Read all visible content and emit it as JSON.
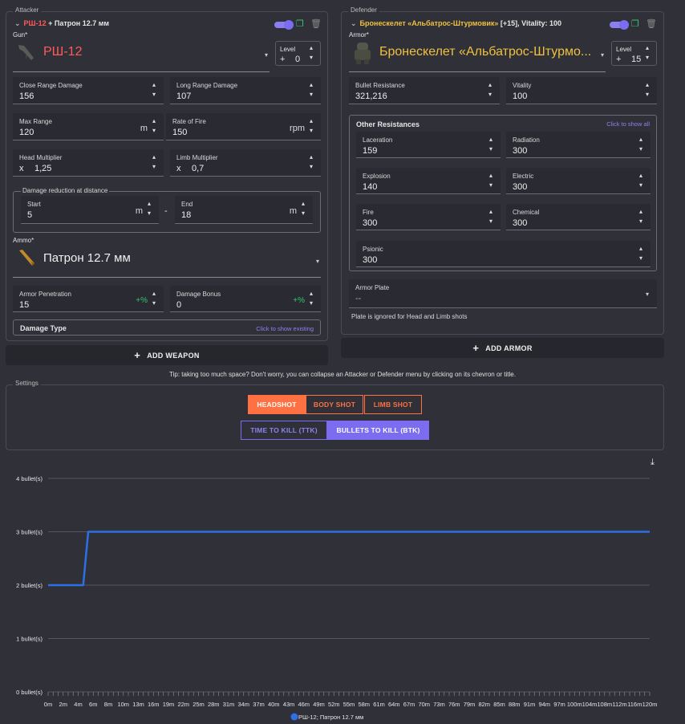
{
  "attacker": {
    "legend": "Attacker",
    "title_weapon": "РШ-12",
    "title_rest": "+ Патрон 12.7 мм",
    "gun_label": "Gun*",
    "gun_name": "РШ-12",
    "level_label": "Level",
    "level_plus": "+",
    "level_value": "0",
    "close_range_damage": {
      "label": "Close Range Damage",
      "value": "156"
    },
    "long_range_damage": {
      "label": "Long Range Damage",
      "value": "107"
    },
    "max_range": {
      "label": "Max Range",
      "value": "120",
      "unit": "m"
    },
    "rate_of_fire": {
      "label": "Rate of Fire",
      "value": "150",
      "unit": "rpm"
    },
    "head_multiplier": {
      "label": "Head Multiplier",
      "prefix": "x",
      "value": "1,25"
    },
    "limb_multiplier": {
      "label": "Limb Multiplier",
      "prefix": "x",
      "value": "0,7"
    },
    "damage_reduction": {
      "label": "Damage reduction at distance",
      "start_label": "Start",
      "start_value": "5",
      "start_unit": "m",
      "dash": "-",
      "end_label": "End",
      "end_value": "18",
      "end_unit": "m"
    },
    "ammo_label": "Ammo*",
    "ammo_name": "Патрон 12.7 мм",
    "armor_penetration": {
      "label": "Armor Penetration",
      "value": "15",
      "unit": "+%"
    },
    "damage_bonus": {
      "label": "Damage Bonus",
      "value": "0",
      "unit": "+%"
    },
    "damage_type": {
      "label": "Damage Type",
      "link": "Click to show existing"
    },
    "add_weapon": "ADD WEAPON"
  },
  "defender": {
    "legend": "Defender",
    "title_armor": "Бронескелет «Альбатрос-Штурмовик»",
    "title_rest": "[+15], Vitality: 100",
    "armor_label": "Armor*",
    "armor_name": "Бронескелет «Альбатрос-Штурмо...",
    "level_label": "Level",
    "level_plus": "+",
    "level_value": "15",
    "bullet_resistance": {
      "label": "Bullet Resistance",
      "value": "321,216"
    },
    "vitality": {
      "label": "Vitality",
      "value": "100"
    },
    "other_resistances": {
      "label": "Other Resistances",
      "link": "Click to show all",
      "laceration": {
        "label": "Laceration",
        "value": "159"
      },
      "radiation": {
        "label": "Radiation",
        "value": "300"
      },
      "explosion": {
        "label": "Explosion",
        "value": "140"
      },
      "electric": {
        "label": "Electric",
        "value": "300"
      },
      "fire": {
        "label": "Fire",
        "value": "300"
      },
      "chemical": {
        "label": "Chemical",
        "value": "300"
      },
      "psionic": {
        "label": "Psionic",
        "value": "300"
      }
    },
    "armor_plate": {
      "label": "Armor Plate",
      "value": "--"
    },
    "plate_note": "Plate is ignored for Head and Limb shots",
    "add_armor": "ADD ARMOR"
  },
  "tip": "Tip: taking too much space? Don't worry, you can collapse an Attacker or Defender menu by clicking on its chevron or title.",
  "settings": {
    "legend": "Settings",
    "shot_buttons": [
      "HEADSHOT",
      "BODY SHOT",
      "LIMB SHOT"
    ],
    "shot_selected": "HEADSHOT",
    "mode_buttons": [
      "TIME TO KILL (TTK)",
      "BULLETS TO KILL (BTK)"
    ],
    "mode_selected": "BULLETS TO KILL (BTK)"
  },
  "colors": {
    "accent_orange": "#ff7043",
    "accent_purple": "#7c6cf0",
    "series_blue": "#2f6fe6",
    "attacker_red": "#ff5a5a",
    "defender_gold": "#f0c040"
  },
  "icons": {
    "chevron": "chevron-down-icon",
    "copy": "copy-icon",
    "delete": "trash-icon",
    "download": "download-icon",
    "add": "plus-icon"
  },
  "chart_data": {
    "type": "line",
    "title": "",
    "xlabel": "",
    "ylabel": "",
    "ylim": [
      0,
      4
    ],
    "y_ticks": [
      "0 bullet(s)",
      "1 bullet(s)",
      "2 bullet(s)",
      "3 bullet(s)",
      "4 bullet(s)"
    ],
    "x_tick_labels": [
      "0m",
      "2m",
      "4m",
      "6m",
      "8m",
      "10m",
      "13m",
      "16m",
      "19m",
      "22m",
      "25m",
      "28m",
      "31m",
      "34m",
      "37m",
      "40m",
      "43m",
      "46m",
      "49m",
      "52m",
      "55m",
      "58m",
      "61m",
      "64m",
      "67m",
      "70m",
      "73m",
      "76m",
      "79m",
      "82m",
      "85m",
      "88m",
      "91m",
      "94m",
      "97m",
      "100m",
      "104m",
      "108m",
      "112m",
      "116m",
      "120m"
    ],
    "grid": true,
    "legend_position": "bottom",
    "series": [
      {
        "name": "РШ-12; Патрон 12.7 мм",
        "x": [
          0,
          7,
          8,
          120
        ],
        "y": [
          2,
          2,
          3,
          3
        ]
      }
    ]
  }
}
